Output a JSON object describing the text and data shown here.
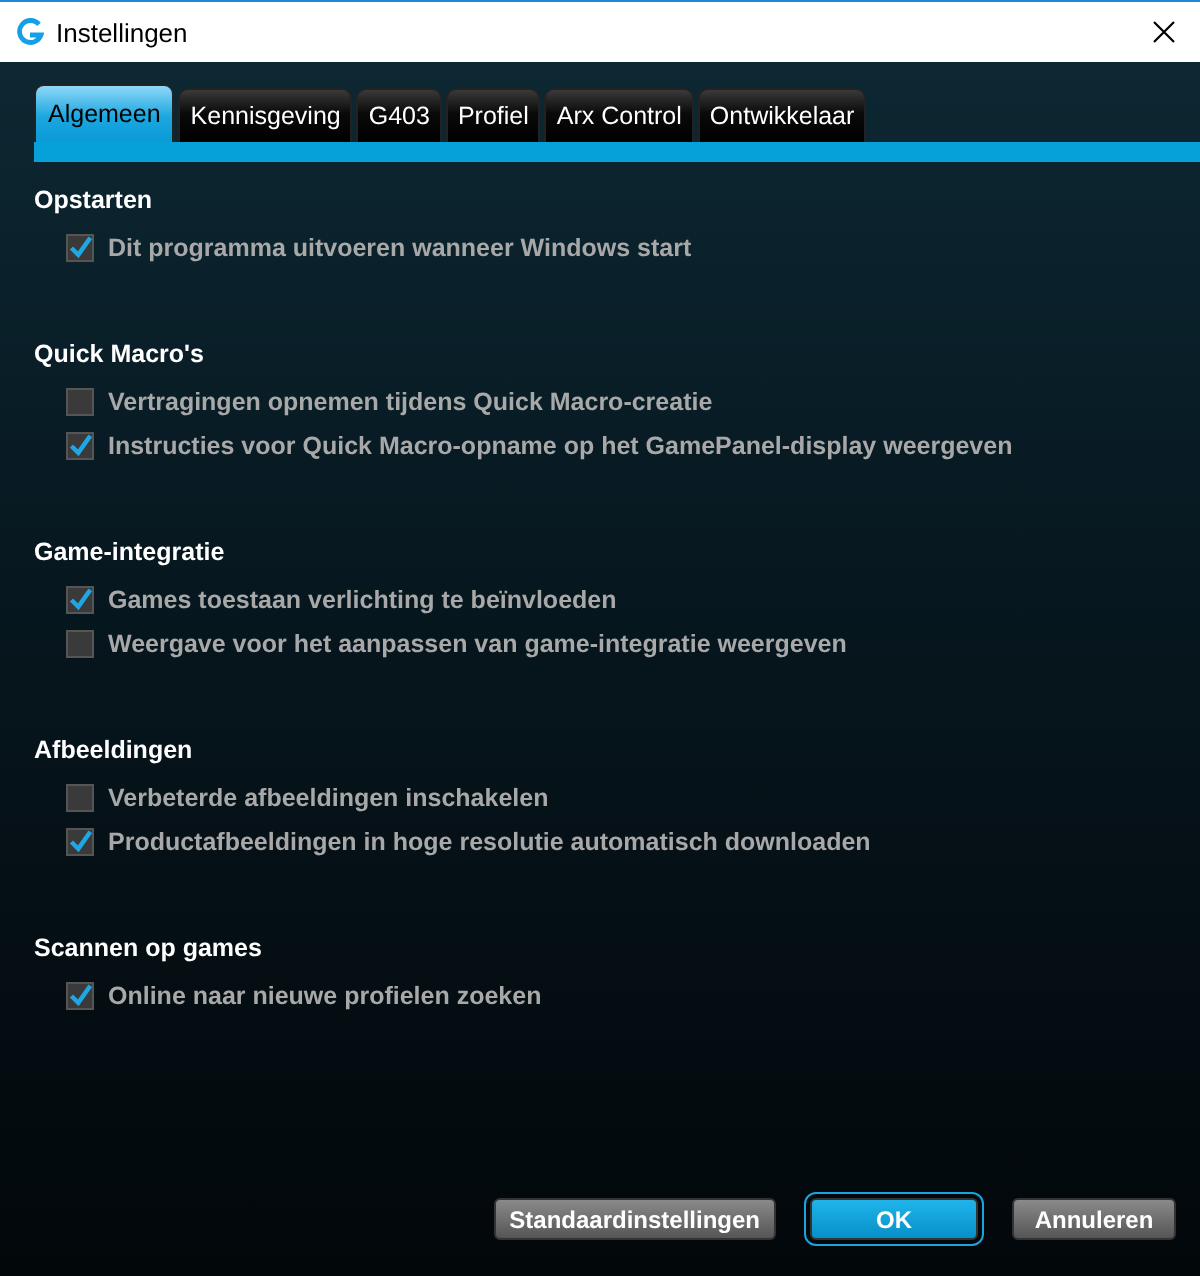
{
  "window": {
    "title": "Instellingen"
  },
  "tabs": [
    {
      "label": "Algemeen",
      "selected": true
    },
    {
      "label": "Kennisgeving",
      "selected": false
    },
    {
      "label": "G403",
      "selected": false
    },
    {
      "label": "Profiel",
      "selected": false
    },
    {
      "label": "Arx Control",
      "selected": false
    },
    {
      "label": "Ontwikkelaar",
      "selected": false
    }
  ],
  "sections": [
    {
      "title": "Opstarten",
      "options": [
        {
          "label": "Dit programma uitvoeren wanneer Windows start",
          "checked": true
        }
      ]
    },
    {
      "title": "Quick Macro's",
      "options": [
        {
          "label": "Vertragingen opnemen tijdens Quick Macro-creatie",
          "checked": false
        },
        {
          "label": "Instructies voor Quick Macro-opname op het GamePanel-display weergeven",
          "checked": true
        }
      ]
    },
    {
      "title": "Game-integratie",
      "options": [
        {
          "label": "Games toestaan verlichting te beïnvloeden",
          "checked": true
        },
        {
          "label": "Weergave voor het aanpassen van game-integratie weergeven",
          "checked": false
        }
      ]
    },
    {
      "title": "Afbeeldingen",
      "options": [
        {
          "label": "Verbeterde afbeeldingen inschakelen",
          "checked": false
        },
        {
          "label": "Productafbeeldingen in hoge resolutie automatisch downloaden",
          "checked": true
        }
      ]
    },
    {
      "title": "Scannen op games",
      "options": [
        {
          "label": "Online naar nieuwe profielen zoeken",
          "checked": true
        }
      ]
    }
  ],
  "buttons": [
    {
      "label": "Standaardinstellingen",
      "kind": "secondary"
    },
    {
      "label": "OK",
      "kind": "primary"
    },
    {
      "label": "Annuleren",
      "kind": "secondary"
    }
  ]
}
